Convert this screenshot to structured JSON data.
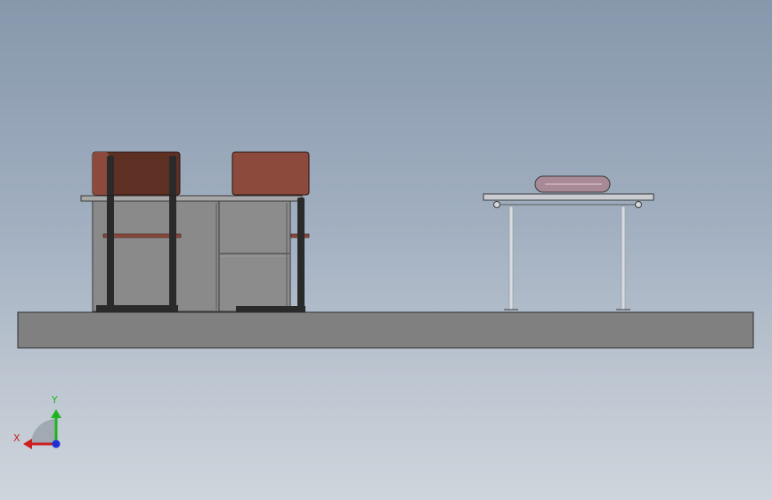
{
  "viewport": {
    "background_top": "#8798ac",
    "background_bottom": "#cfd5dc"
  },
  "scene": {
    "floor_color": "#808080",
    "cabinet_color": "#8a8a8a",
    "frame_color": "#2a2a2a",
    "box_color": "#8c4a3c",
    "box_dark_color": "#5e3024",
    "steel_color": "#c9ccd1"
  },
  "triad": {
    "x_label": "X",
    "y_label": "Y",
    "x_color": "#cc1f1f",
    "y_color": "#1fb51f",
    "z_color": "#1f2fd6"
  }
}
